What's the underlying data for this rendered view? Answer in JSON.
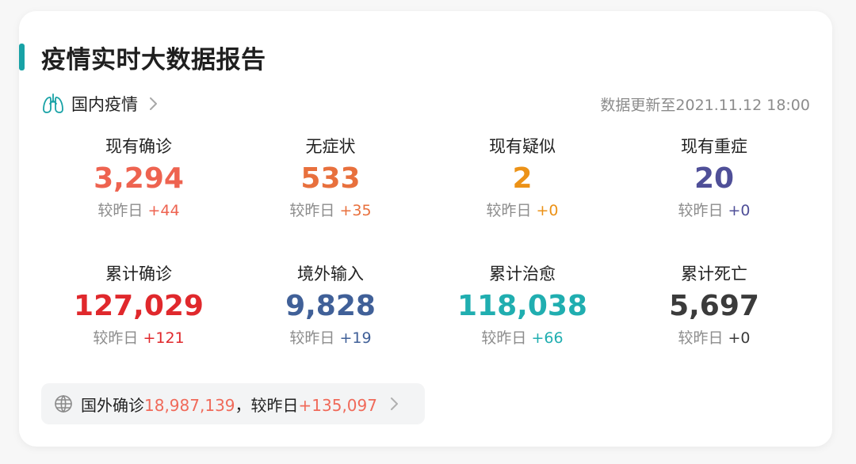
{
  "header": {
    "title": "疫情实时大数据报告"
  },
  "domestic": {
    "label": "国内疫情",
    "update_text": "数据更新至2021.11.12 18:00"
  },
  "stats": [
    {
      "label": "现有确诊",
      "value": "3,294",
      "delta_prefix": "较昨日",
      "delta": "+44",
      "color": "#ee6350"
    },
    {
      "label": "无症状",
      "value": "533",
      "delta_prefix": "较昨日",
      "delta": "+35",
      "color": "#e8703d"
    },
    {
      "label": "现有疑似",
      "value": "2",
      "delta_prefix": "较昨日",
      "delta": "+0",
      "color": "#ec9217"
    },
    {
      "label": "现有重症",
      "value": "20",
      "delta_prefix": "较昨日",
      "delta": "+0",
      "color": "#4f4f98"
    },
    {
      "label": "累计确诊",
      "value": "127,029",
      "delta_prefix": "较昨日",
      "delta": "+121",
      "color": "#e0282c"
    },
    {
      "label": "境外输入",
      "value": "9,828",
      "delta_prefix": "较昨日",
      "delta": "+19",
      "color": "#406098"
    },
    {
      "label": "累计治愈",
      "value": "118,038",
      "delta_prefix": "较昨日",
      "delta": "+66",
      "color": "#20aeb0"
    },
    {
      "label": "累计死亡",
      "value": "5,697",
      "delta_prefix": "较昨日",
      "delta": "+0",
      "color": "#3b3b3b"
    }
  ],
  "foreign": {
    "label": "国外确诊",
    "value": "18,987,139",
    "separator": "，",
    "delta_prefix": "较昨日",
    "delta": "+135,097",
    "value_color": "#f06a5a"
  },
  "theme": {
    "accent": "#18a2a6",
    "muted": "#8c8c8c"
  },
  "icons": {
    "domestic": "lungs-icon",
    "foreign": "globe-icon",
    "more": "chevron-right-icon"
  }
}
